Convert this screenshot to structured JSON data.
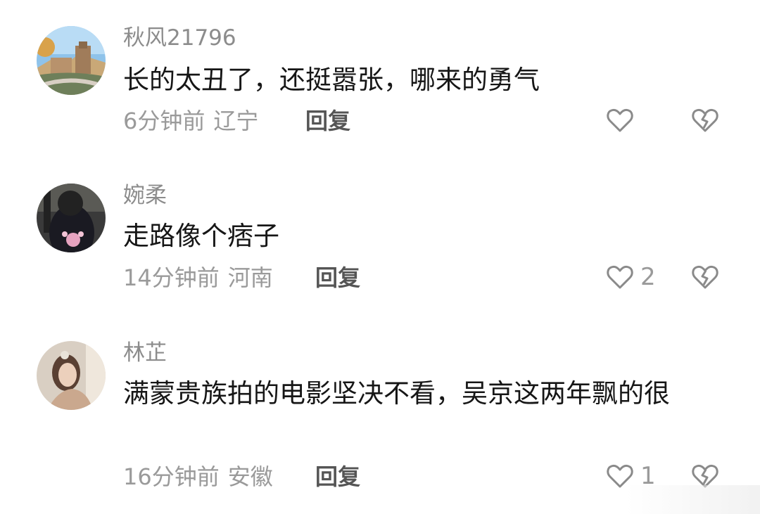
{
  "comments": [
    {
      "username": "秋风21796",
      "text": "长的太丑了，还挺嚣张，哪来的勇气",
      "time": "6分钟前",
      "location": "辽宁",
      "reply_label": "回复",
      "like_count": ""
    },
    {
      "username": "婉柔",
      "text": "走路像个痞子",
      "time": "14分钟前",
      "location": "河南",
      "reply_label": "回复",
      "like_count": "2"
    },
    {
      "username": "林芷",
      "text": "满蒙贵族拍的电影坚决不看，吴京这两年飘的很",
      "time": "16分钟前",
      "location": "安徽",
      "reply_label": "回复",
      "like_count": "1"
    }
  ],
  "icons": {
    "like": "heart-outline-icon",
    "dislike": "broken-heart-icon"
  },
  "colors": {
    "username": "#8c8c8c",
    "text": "#161616",
    "meta": "#9a9a9a",
    "icon": "#8a8a8a"
  }
}
